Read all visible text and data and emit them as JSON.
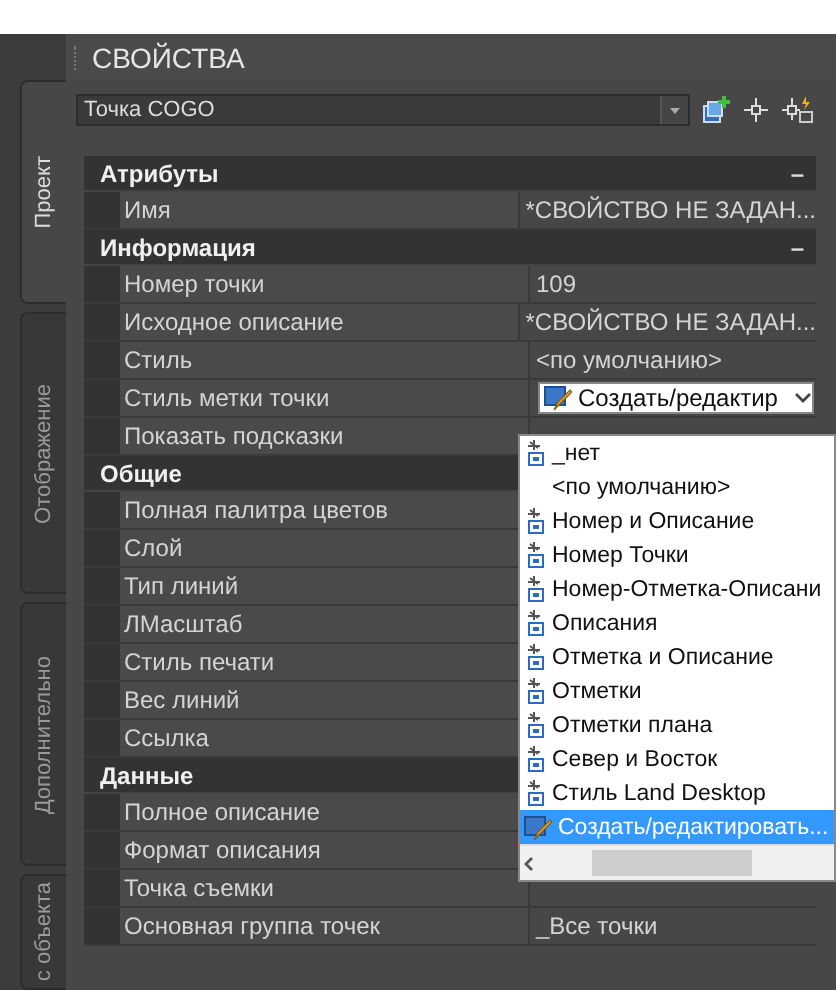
{
  "panel_title": "СВОЙСТВА",
  "side_tabs": [
    {
      "label": "Проект",
      "selected": true
    },
    {
      "label": "Отображение",
      "selected": false
    },
    {
      "label": "Дополнительно",
      "selected": false
    },
    {
      "label": "с объекта",
      "selected": false
    }
  ],
  "object_selector": {
    "value": "Точка COGO"
  },
  "categories": [
    {
      "name": "Атрибуты",
      "toggle": "–",
      "properties": [
        {
          "label": "Имя",
          "kind": "text",
          "value": "*СВОЙСТВО НЕ ЗАДАН..."
        }
      ]
    },
    {
      "name": "Информация",
      "toggle": "–",
      "properties": [
        {
          "label": "Номер точки",
          "kind": "text",
          "value": "109"
        },
        {
          "label": "Исходное описание",
          "kind": "text",
          "value": "*СВОЙСТВО НЕ ЗАДАН..."
        },
        {
          "label": "Стиль",
          "kind": "text",
          "value": "<по умолчанию>"
        },
        {
          "label": "Стиль метки точки",
          "kind": "dropdown",
          "value": "Создать/редактир"
        },
        {
          "label": "Показать подсказки",
          "kind": "text"
        }
      ]
    },
    {
      "name": "Общие",
      "properties": [
        {
          "label": "Полная палитра цветов",
          "kind": "text"
        },
        {
          "label": "Слой",
          "kind": "text"
        },
        {
          "label": "Тип линий",
          "kind": "text"
        },
        {
          "label": "ЛМасштаб",
          "kind": "text"
        },
        {
          "label": "Стиль печати",
          "kind": "text"
        },
        {
          "label": "Вес линий",
          "kind": "text"
        },
        {
          "label": "Ссылка",
          "kind": "text"
        }
      ]
    },
    {
      "name": "Данные",
      "properties": [
        {
          "label": "Полное описание",
          "kind": "text"
        },
        {
          "label": "Формат описания",
          "kind": "text"
        },
        {
          "label": "Точка съемки",
          "kind": "text"
        },
        {
          "label": "Основная группа точек",
          "kind": "text",
          "value": "_Все точки"
        }
      ]
    }
  ],
  "style_list": {
    "items": [
      {
        "label": "_нет",
        "kind": "style",
        "selected": false
      },
      {
        "label": "<по умолчанию>",
        "kind": "plain",
        "selected": false
      },
      {
        "label": "Номер и Описание",
        "kind": "style",
        "selected": false
      },
      {
        "label": "Номер Точки",
        "kind": "style",
        "selected": false
      },
      {
        "label": "Номер-Отметка-Описани",
        "kind": "style",
        "selected": false
      },
      {
        "label": "Описания",
        "kind": "style",
        "selected": false
      },
      {
        "label": "Отметка и Описание",
        "kind": "style",
        "selected": false
      },
      {
        "label": "Отметки",
        "kind": "style",
        "selected": false
      },
      {
        "label": "Отметки плана",
        "kind": "style",
        "selected": false
      },
      {
        "label": "Север и Восток",
        "kind": "style",
        "selected": false
      },
      {
        "label": "Стиль Land Desktop",
        "kind": "style",
        "selected": false
      },
      {
        "label": "Создать/редактировать...",
        "kind": "edit",
        "selected": true
      }
    ]
  }
}
